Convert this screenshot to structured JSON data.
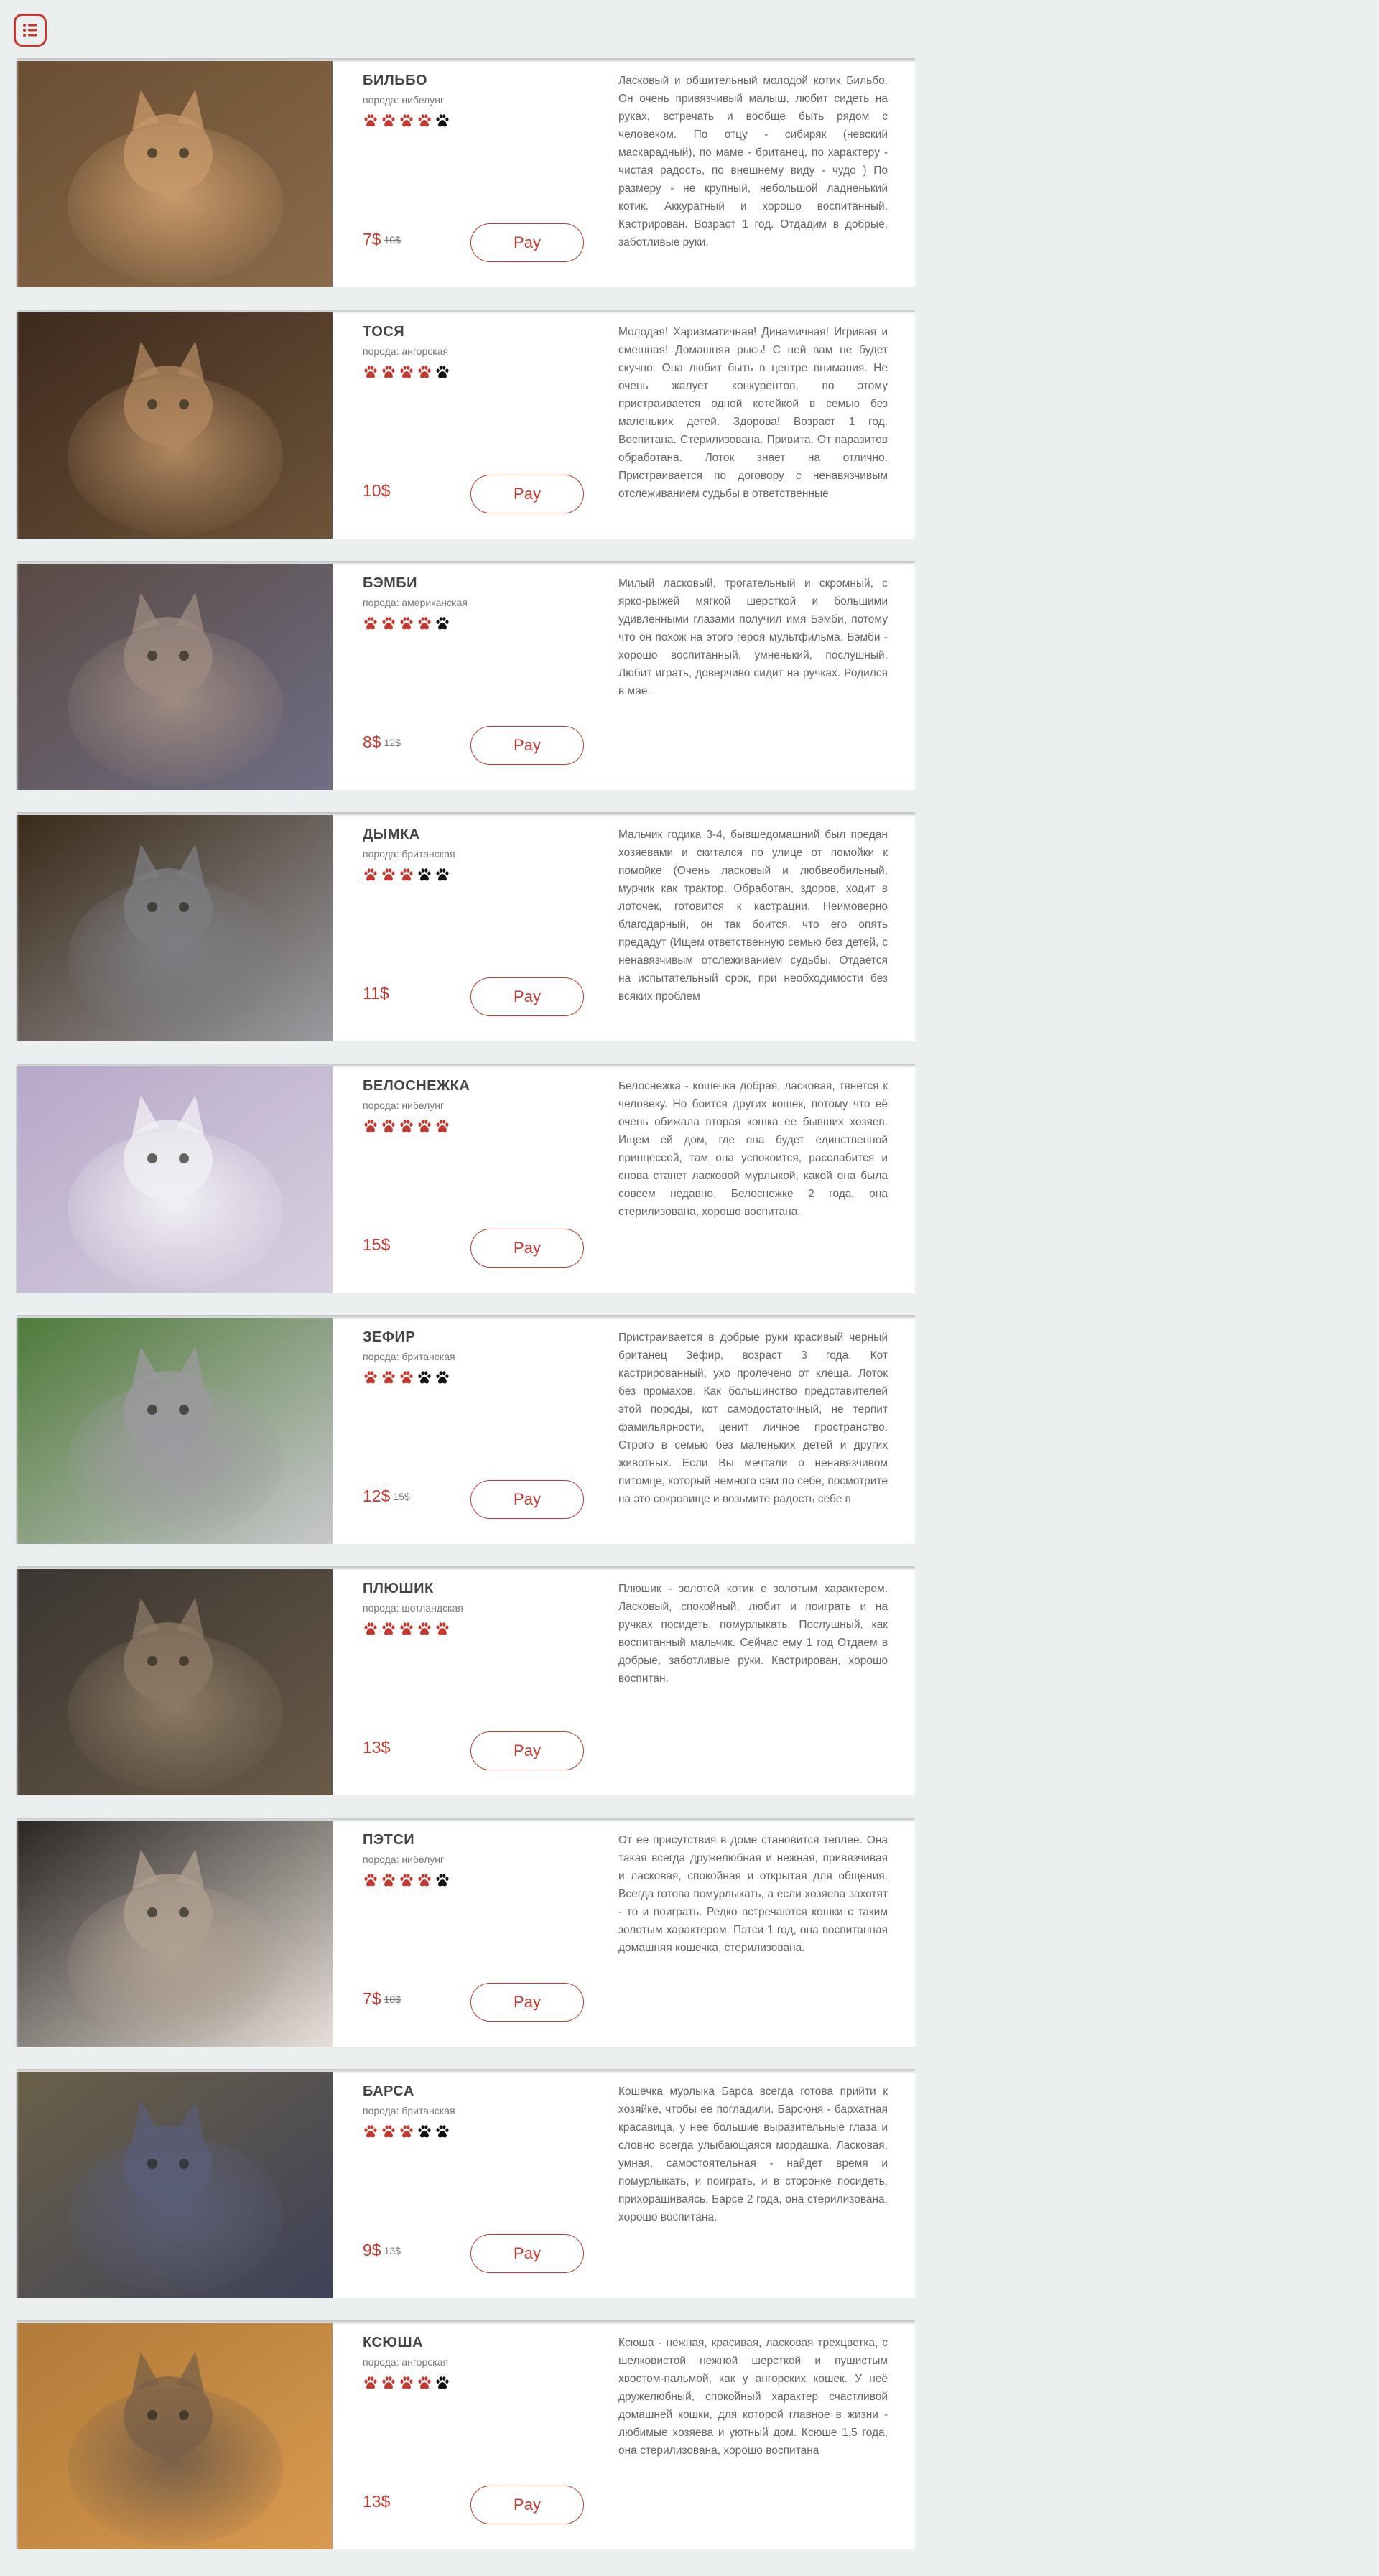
{
  "menu": {
    "icon": "list-icon"
  },
  "pay_label": "Pay",
  "colors": {
    "accent": "#c4392f",
    "paw_active": "#c4392f",
    "paw_inactive": "#111111"
  },
  "cats": [
    {
      "name": "БИЛЬБО",
      "breed": "порода: нибелунг",
      "rating": 4,
      "price": "7$",
      "old_price": "10$",
      "description": "Ласковый и общительный молодой котик Бильбо. Он очень привязчивый малыш, любит сидеть на руках, встречать и вообще быть рядом с человеком. По отцу - сибиряк (невский маскарадный), по маме - британец, по характеру - чистая радость, по внешнему виду - чудо ) По размеру - не крупный, небольшой ладненький котик. Аккуратный и хорошо воспитанный. Кастрирован. Возраст 1 год. Отдадим в добрые, заботливые руки."
    },
    {
      "name": "ТОСЯ",
      "breed": "порода: ангорская",
      "rating": 4,
      "price": "10$",
      "old_price": "",
      "description": "Молодая! Харизматичная! Динамичная! Игривая и смешная! Домашняя рысь! С ней вам не будет скучно. Она любит быть в центре внимания. Не очень жалует конкурентов, по этому пристраивается одной котейкой в семью без маленьких детей. Здорова! Возраст 1 год. Воспитана. Стерилизована. Привита. От паразитов обработана. Лоток знает на отлично. Пристраивается по договору с ненавязчивым отслеживанием судьбы в ответственные"
    },
    {
      "name": "БЭМБИ",
      "breed": "порода: американская",
      "rating": 4,
      "price": "8$",
      "old_price": "12$",
      "description": "Милый ласковый, трогательный и скромный, с ярко-рыжей мягкой шерсткой и большими удивленными глазами получил имя Бэмби, потому что он похож на этого героя мультфильма. Бэмби - хорошо воспитанный, умненький, послушный. Любит играть, доверчиво сидит на ручках. Родился в мае."
    },
    {
      "name": "ДЫМКА",
      "breed": "порода: британская",
      "rating": 3,
      "price": "11$",
      "old_price": "",
      "description": "Мальчик годика 3-4, бывшедомашний был предан хозяевами и скитался по улице от помойки к помойке (Очень ласковый и любвеобильный, мурчик как трактор. Обработан, здоров, ходит в лоточек, готовится к кастрации. Неимоверно благодарный, он так боится, что его опять предадут (Ищем ответственную семью без детей, с ненавязчивым отслеживанием судьбы. Отдается на испытательный срок, при необходимости без всяких проблем"
    },
    {
      "name": "БЕЛОСНЕЖКА",
      "breed": "порода: нибелунг",
      "rating": 5,
      "price": "15$",
      "old_price": "",
      "description": "Белоснежка - кошечка добрая, ласковая, тянется к человеку. Но боится других кошек, потому что её очень обижала вторая кошка ее бывших хозяев. Ищем ей дом, где она будет единственной принцессой, там она успокоится, расслабится и снова станет ласковой мурлыкой, какой она была совсем недавно. Белоснежке 2 года, она стерилизована, хорошо воспитана."
    },
    {
      "name": "ЗЕФИР",
      "breed": "порода: британская",
      "rating": 3,
      "price": "12$",
      "old_price": "15$",
      "description": "Пристраивается в добрые руки красивый черный британец Зефир, возраст 3 года. Кот кастрированный, ухо пролечено от клеща. Лоток без промахов. Как большинство представителей этой породы, кот самодостаточный, не терпит фамильярности, ценит личное пространство. Строго в семью без маленьких детей и других животных. Если Вы мечтали о ненавязчивом питомце, который немного сам по себе, посмотрите на это сокровище и возьмите радость себе в"
    },
    {
      "name": "ПЛЮШИК",
      "breed": "порода: шотландская",
      "rating": 5,
      "price": "13$",
      "old_price": "",
      "description": "Плюшик - золотой котик с золотым характером. Ласковый, спокойный, любит и поиграть и на ручках посидеть, помурлыкать. Послушный, как воспитанный мальчик. Сейчас ему 1 год Отдаем в добрые, заботливые руки. Кастрирован, хорошо воспитан."
    },
    {
      "name": "ПЭТСИ",
      "breed": "порода: нибелунг",
      "rating": 4,
      "price": "7$",
      "old_price": "10$",
      "description": "От ее присутствия в доме становится теплее. Она такая всегда дружелюбная и нежная, привязчивая и ласковая, спокойная и открытая для общения. Всегда готова помурлыкать, а если хозяева захотят - то и поиграть. Редко встречаются кошки с таким золотым характером. Пэтси 1 год, она воспитанная домашняя кошечка, стерилизована."
    },
    {
      "name": "БАРСА",
      "breed": "порода: британская",
      "rating": 3,
      "price": "9$",
      "old_price": "13$",
      "description": "Кошечка мурлыка Барса всегда готова прийти к хозяйке, чтобы ее погладили. Барсюня - бархатная красавица, у нее большие выразительные глаза и словно всегда улыбающаяся мордашка. Ласковая, умная, самостоятельная - найдет время и помурлыкать, и поиграть, и в сторонке посидеть, прихорашиваясь. Барсе 2 года, она стерилизована, хорошо воспитана."
    },
    {
      "name": "КСЮША",
      "breed": "порода: ангорская",
      "rating": 4,
      "price": "13$",
      "old_price": "",
      "description": "Ксюша - нежная, красивая, ласковая трехцветка, с шелковистой нежной шерсткой и пушистым хвостом-пальмой, как у ангорских кошек. У неё дружелюбный, спокойный характер счастливой домашней кошки, для которой главное в жизни - любимые хозяева и уютный дом. Ксюше 1,5 года, она стерилизована, хорошо воспитана"
    }
  ]
}
